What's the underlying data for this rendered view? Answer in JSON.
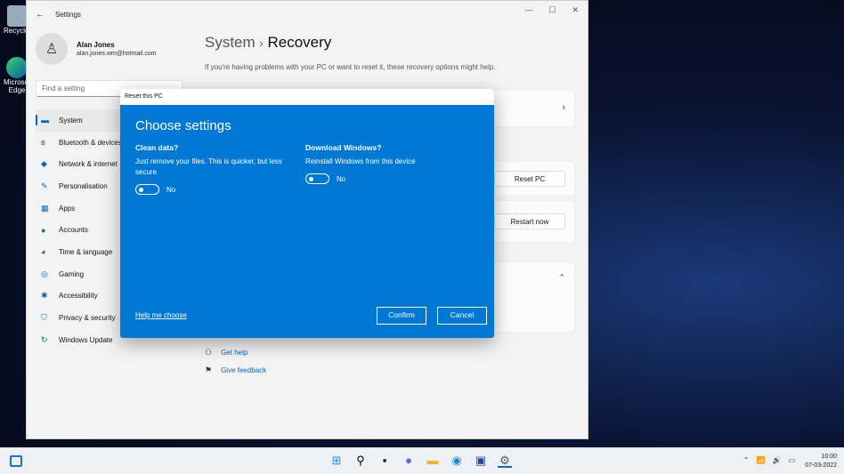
{
  "desktop": {
    "icons": [
      {
        "label": "Recycle Bin"
      },
      {
        "label": "Microsoft Edge"
      }
    ]
  },
  "window": {
    "title": "Settings",
    "back": "←",
    "controls": [
      "—",
      "☐",
      "✕"
    ]
  },
  "user": {
    "name": "Alan Jones",
    "email": "alan.jones.wm@hotmail.com"
  },
  "search": {
    "placeholder": "Find a setting"
  },
  "nav": [
    {
      "label": "System",
      "icon": "system-icon",
      "glyph": "▬"
    },
    {
      "label": "Bluetooth & devices",
      "icon": "bluetooth-icon",
      "glyph": "ʙ"
    },
    {
      "label": "Network & internet",
      "icon": "wifi-icon",
      "glyph": "◆"
    },
    {
      "label": "Personalisation",
      "icon": "brush-icon",
      "glyph": "✎"
    },
    {
      "label": "Apps",
      "icon": "apps-icon",
      "glyph": "▦"
    },
    {
      "label": "Accounts",
      "icon": "account-icon",
      "glyph": "●"
    },
    {
      "label": "Time & language",
      "icon": "globe-clock-icon",
      "glyph": "◕"
    },
    {
      "label": "Gaming",
      "icon": "gamepad-icon",
      "glyph": "◎"
    },
    {
      "label": "Accessibility",
      "icon": "accessibility-icon",
      "glyph": "✱"
    },
    {
      "label": "Privacy & security",
      "icon": "shield-icon",
      "glyph": "⛉"
    },
    {
      "label": "Windows Update",
      "icon": "update-icon",
      "glyph": "↻"
    }
  ],
  "page": {
    "breadcrumb_parent": "System",
    "separator": "›",
    "title": "Recovery",
    "subtitle": "If you're having problems with your PC or want to reset it, these recovery options might help.",
    "reset_button": "Reset PC",
    "restart_button": "Restart now",
    "get_help": "Get help",
    "give_feedback": "Give feedback"
  },
  "dialog": {
    "window_title": "Reset this PC",
    "heading": "Choose settings",
    "clean": {
      "title": "Clean data?",
      "desc": "Just remove your files. This is quicker, but less secure",
      "state": "No",
      "on": false
    },
    "download": {
      "title": "Download Windows?",
      "desc": "Reinstall Windows from this device",
      "state": "No",
      "on": false
    },
    "help_link": "Help me choose",
    "confirm": "Confirm",
    "cancel": "Cancel"
  },
  "taskbar": {
    "time": "10:00",
    "date": "07-03-2022"
  },
  "colors": {
    "accent": "#0078d4",
    "link": "#0067c0"
  }
}
